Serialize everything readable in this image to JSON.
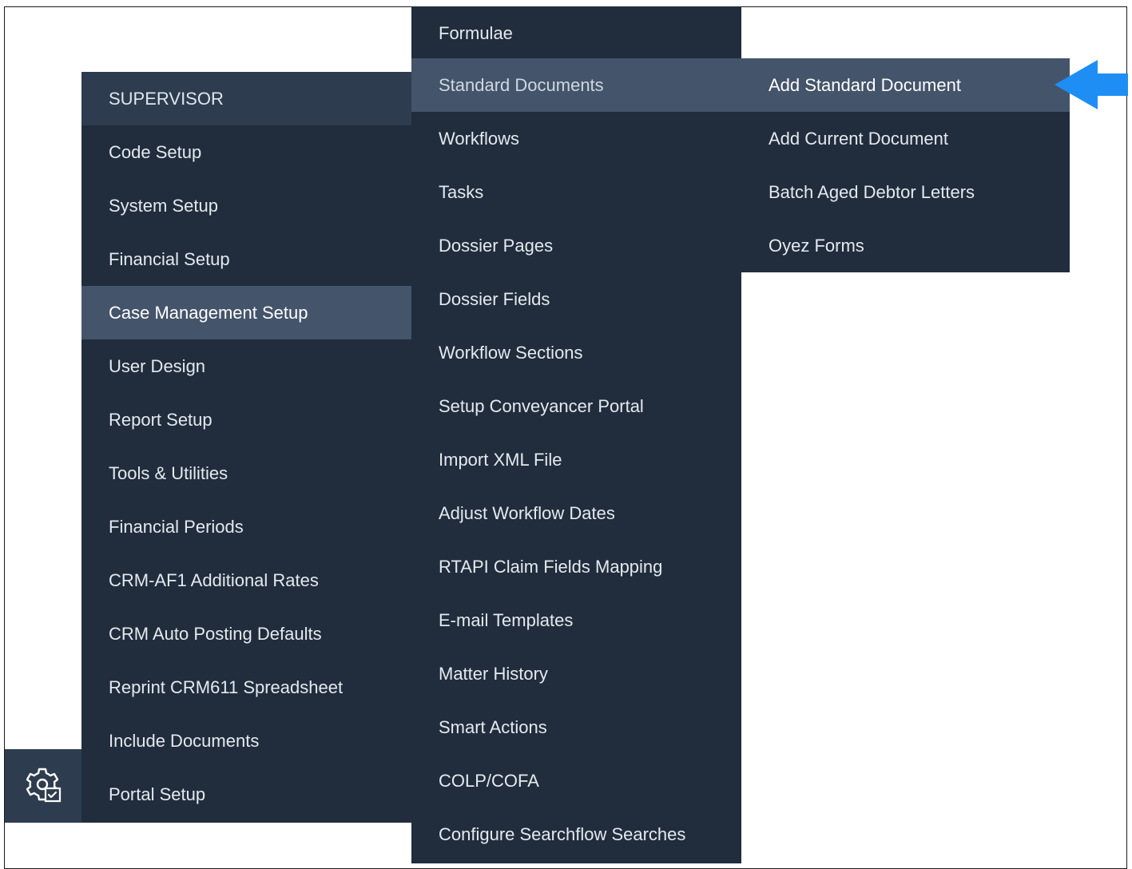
{
  "menus": {
    "main": {
      "header": "SUPERVISOR",
      "items": [
        {
          "label": "Code Setup"
        },
        {
          "label": "System Setup"
        },
        {
          "label": "Financial Setup"
        },
        {
          "label": "Case Management Setup"
        },
        {
          "label": "User Design"
        },
        {
          "label": "Report Setup"
        },
        {
          "label": "Tools & Utilities"
        },
        {
          "label": "Financial Periods"
        },
        {
          "label": "CRM-AF1 Additional Rates"
        },
        {
          "label": "CRM Auto Posting Defaults"
        },
        {
          "label": "Reprint CRM611 Spreadsheet"
        },
        {
          "label": "Include Documents"
        },
        {
          "label": "Portal Setup"
        }
      ],
      "active_item": "Case Management Setup"
    },
    "case_management": {
      "items": [
        {
          "label": "Formulae"
        },
        {
          "label": "Standard Documents"
        },
        {
          "label": "Workflows"
        },
        {
          "label": "Tasks"
        },
        {
          "label": "Dossier Pages"
        },
        {
          "label": "Dossier Fields"
        },
        {
          "label": "Workflow Sections"
        },
        {
          "label": "Setup Conveyancer Portal"
        },
        {
          "label": "Import XML File"
        },
        {
          "label": "Adjust Workflow Dates"
        },
        {
          "label": "RTAPI Claim Fields Mapping"
        },
        {
          "label": "E-mail Templates"
        },
        {
          "label": "Matter History"
        },
        {
          "label": "Smart Actions"
        },
        {
          "label": "COLP/COFA"
        },
        {
          "label": "Configure Searchflow Searches"
        }
      ],
      "active_item": "Standard Documents"
    },
    "standard_documents": {
      "items": [
        {
          "label": "Add Standard Document"
        },
        {
          "label": "Add Current Document"
        },
        {
          "label": "Batch Aged Debtor Letters"
        },
        {
          "label": "Oyez Forms"
        }
      ],
      "active_item": "Add Standard Document"
    }
  },
  "icons": {
    "settings_tile": "gear-settings-icon",
    "pointer": "arrow-left-icon"
  },
  "colors": {
    "menu_background": "#212d3d",
    "header_background": "#2e3c4f",
    "active_background": "#44546a",
    "menu_text": "#e4e9ee",
    "arrow_accent": "#1e8ef5"
  }
}
